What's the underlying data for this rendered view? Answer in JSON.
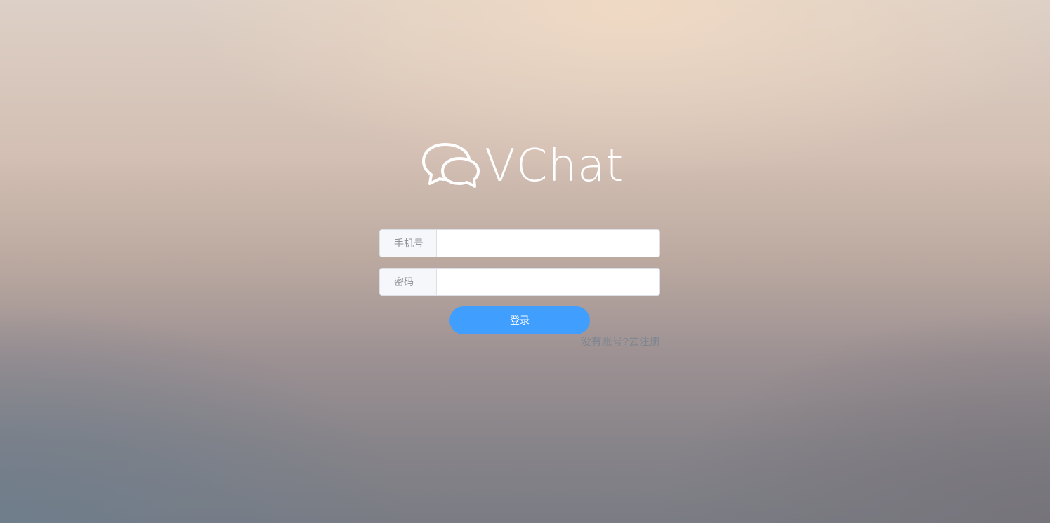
{
  "brand": {
    "name": "VChat",
    "logo_icon": "chat-bubbles-icon",
    "text_color": "#ffffff"
  },
  "form": {
    "phone": {
      "label": "手机号",
      "value": "",
      "placeholder": ""
    },
    "password": {
      "label": "密码",
      "value": "",
      "placeholder": ""
    },
    "login_label": "登录",
    "register_link": "没有账号?去注册"
  },
  "colors": {
    "primary": "#409eff",
    "link": "#7d8690",
    "prepend_bg": "#f5f7fa"
  }
}
